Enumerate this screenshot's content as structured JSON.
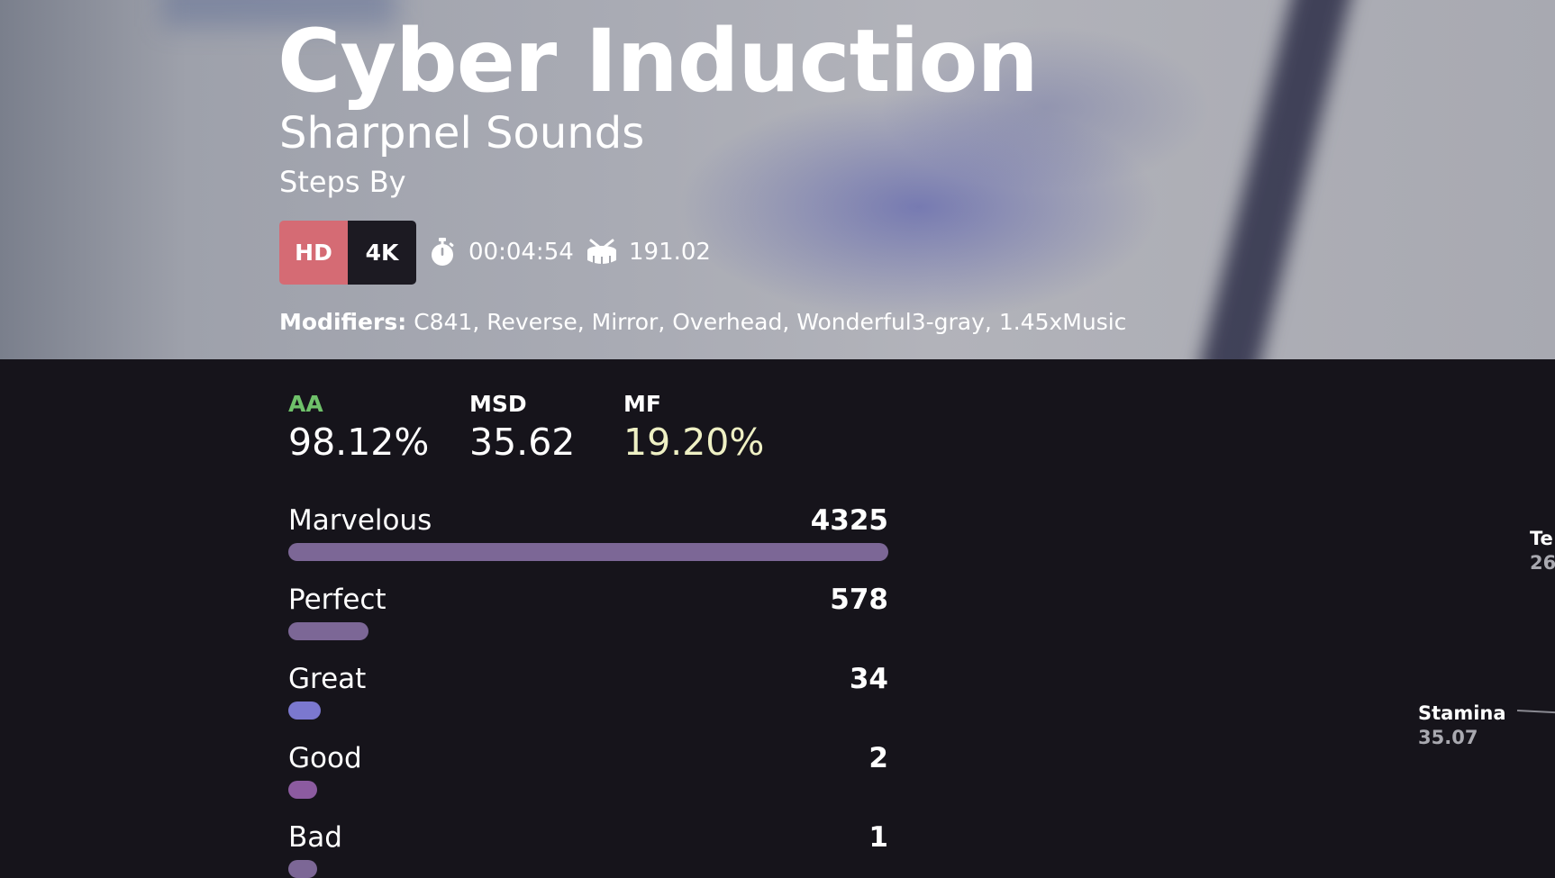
{
  "song": {
    "title": "Cyber Induction",
    "artist": "Sharpnel Sounds",
    "steps_by": "Steps By",
    "difficulty": "HD",
    "keys": "4K",
    "length": "00:04:54",
    "nps": "191.02"
  },
  "modifiers": {
    "label": "Modifiers:",
    "value": "C841, Reverse, Mirror, Overhead, Wonderful3-gray, 1.45xMusic"
  },
  "stats": {
    "grade": {
      "label": "AA",
      "value": "98.12%"
    },
    "msd": {
      "label": "MSD",
      "value": "35.62"
    },
    "mf": {
      "label": "MF",
      "value": "19.20%"
    }
  },
  "judgements": [
    {
      "name": "Marvelous",
      "count": "4325",
      "fraction": 1.0,
      "color": "#7c6796"
    },
    {
      "name": "Perfect",
      "count": "578",
      "fraction": 0.1336,
      "color": "#7c6796"
    },
    {
      "name": "Great",
      "count": "34",
      "fraction": 0.0079,
      "color": "#7b78cf"
    },
    {
      "name": "Good",
      "count": "2",
      "fraction": 0.0005,
      "color": "#8c5ba0"
    },
    {
      "name": "Bad",
      "count": "1",
      "fraction": 0.0002,
      "color": "#7c6796"
    }
  ],
  "skills": [
    {
      "label": "Te",
      "value": "26"
    },
    {
      "label": "Stamina",
      "value": "35.07"
    }
  ],
  "colors": {
    "grade_accent": "#6fc16a",
    "mf_accent": "#eef0c4",
    "difficulty_badge": "#d56b74",
    "keys_badge": "#1c1a22",
    "panel_bg": "#16141b"
  },
  "icons": {
    "length": "stopwatch-icon",
    "nps": "drum-icon"
  }
}
